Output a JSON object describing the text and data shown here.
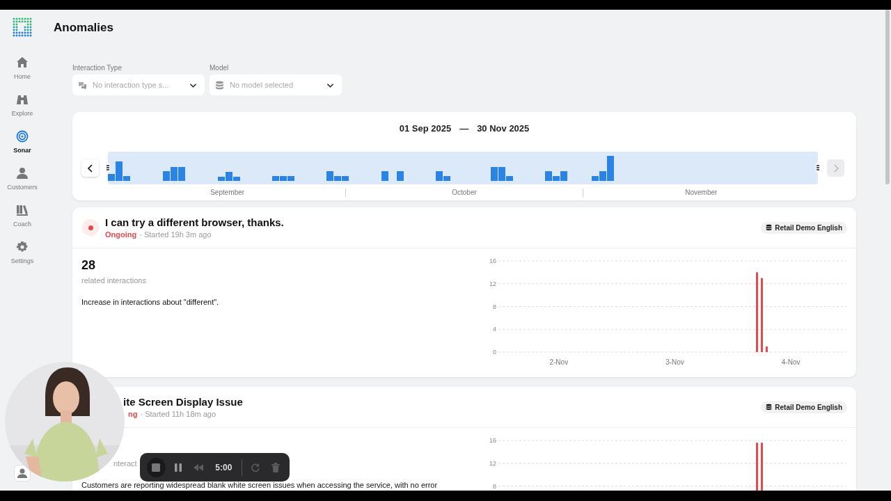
{
  "sidebar": {
    "items": [
      {
        "label": "Home",
        "selected": false
      },
      {
        "label": "Explore",
        "selected": false
      },
      {
        "label": "Sonar",
        "selected": true
      },
      {
        "label": "Customers",
        "selected": false
      },
      {
        "label": "Coach",
        "selected": false
      },
      {
        "label": "Settings",
        "selected": false
      }
    ]
  },
  "page": {
    "title": "Anomalies"
  },
  "filters": [
    {
      "label": "Interaction Type",
      "placeholder": "No interaction type s..."
    },
    {
      "label": "Model",
      "placeholder": "No model selected"
    }
  ],
  "timeline": {
    "start": "01 Sep 2025",
    "separator": "—",
    "end": "30 Nov 2025",
    "months": [
      "September",
      "October",
      "November"
    ],
    "prev_disabled": false,
    "next_disabled": true
  },
  "anomalies": [
    {
      "title": "I can try a different browser, thanks.",
      "status": "Ongoing",
      "started": "· Started 19h 3m ago",
      "model": "Retail Demo English",
      "count": "28",
      "count_label": "related interactions",
      "description": "Increase in interactions about \"different\".",
      "chart_data": {
        "type": "bar",
        "categories": [
          null,
          null,
          null,
          null,
          null,
          null,
          null,
          null,
          null,
          null,
          null,
          null,
          "2-Nov",
          null,
          null,
          null,
          null,
          null,
          null,
          null,
          null,
          null,
          null,
          null,
          null,
          null,
          null,
          null,
          null,
          null,
          null,
          null,
          null,
          null,
          null,
          null,
          "3-Nov",
          null,
          null,
          null,
          null,
          null,
          null,
          null,
          null,
          null,
          null,
          null,
          null,
          null,
          null,
          null,
          null,
          null,
          null,
          null,
          null,
          null,
          null,
          null,
          "4-Nov",
          null,
          null,
          null,
          null,
          null,
          null,
          null,
          null,
          null,
          null,
          null
        ],
        "values": [
          null,
          null,
          null,
          null,
          null,
          null,
          null,
          null,
          null,
          null,
          null,
          null,
          null,
          null,
          null,
          null,
          null,
          null,
          null,
          null,
          null,
          null,
          null,
          null,
          null,
          null,
          null,
          null,
          null,
          null,
          null,
          null,
          null,
          null,
          null,
          null,
          null,
          null,
          null,
          null,
          null,
          null,
          null,
          null,
          null,
          null,
          null,
          null,
          null,
          null,
          null,
          null,
          null,
          14,
          13,
          1,
          null,
          null,
          null,
          null,
          null,
          null,
          null,
          null,
          null,
          null,
          null,
          null,
          null,
          null,
          null,
          null
        ],
        "ylim": [
          0,
          16
        ],
        "yticks": [
          0,
          4,
          8,
          12,
          16
        ],
        "grid": true
      }
    },
    {
      "title": "ite Screen Display Issue",
      "status": "ng",
      "started": "· Started 11h 18m ago",
      "model": "Retail Demo English",
      "count_label": "nteract",
      "description": "Customers are reporting widespread blank white screen issues when accessing the service, with no error",
      "chart_data": {
        "type": "bar",
        "values": [
          null,
          null,
          null,
          null,
          null,
          null,
          null,
          null,
          null,
          null,
          null,
          null,
          null,
          null,
          null,
          null,
          null,
          null,
          null,
          null,
          null,
          null,
          null,
          null,
          null,
          null,
          null,
          null,
          null,
          null,
          null,
          null,
          null,
          null,
          null,
          null,
          null,
          null,
          null,
          null,
          null,
          null,
          null,
          null,
          null,
          null,
          null,
          null,
          null,
          null,
          null,
          null,
          null,
          15.6,
          15.6,
          null,
          null,
          null,
          null,
          null,
          null,
          null,
          null,
          null,
          null,
          null,
          null,
          null,
          null,
          null,
          null,
          null
        ],
        "ylim": [
          0,
          16
        ],
        "yticks": [
          8,
          12,
          16
        ],
        "grid": true
      }
    }
  ],
  "recorder": {
    "controls": [
      {
        "kind": "stop",
        "disabled": false
      },
      {
        "kind": "pause",
        "disabled": false
      },
      {
        "kind": "rewind",
        "disabled": true
      },
      {
        "kind": "time",
        "text": "5:00"
      },
      {
        "kind": "restart",
        "disabled": true
      },
      {
        "kind": "delete",
        "disabled": true
      }
    ]
  }
}
